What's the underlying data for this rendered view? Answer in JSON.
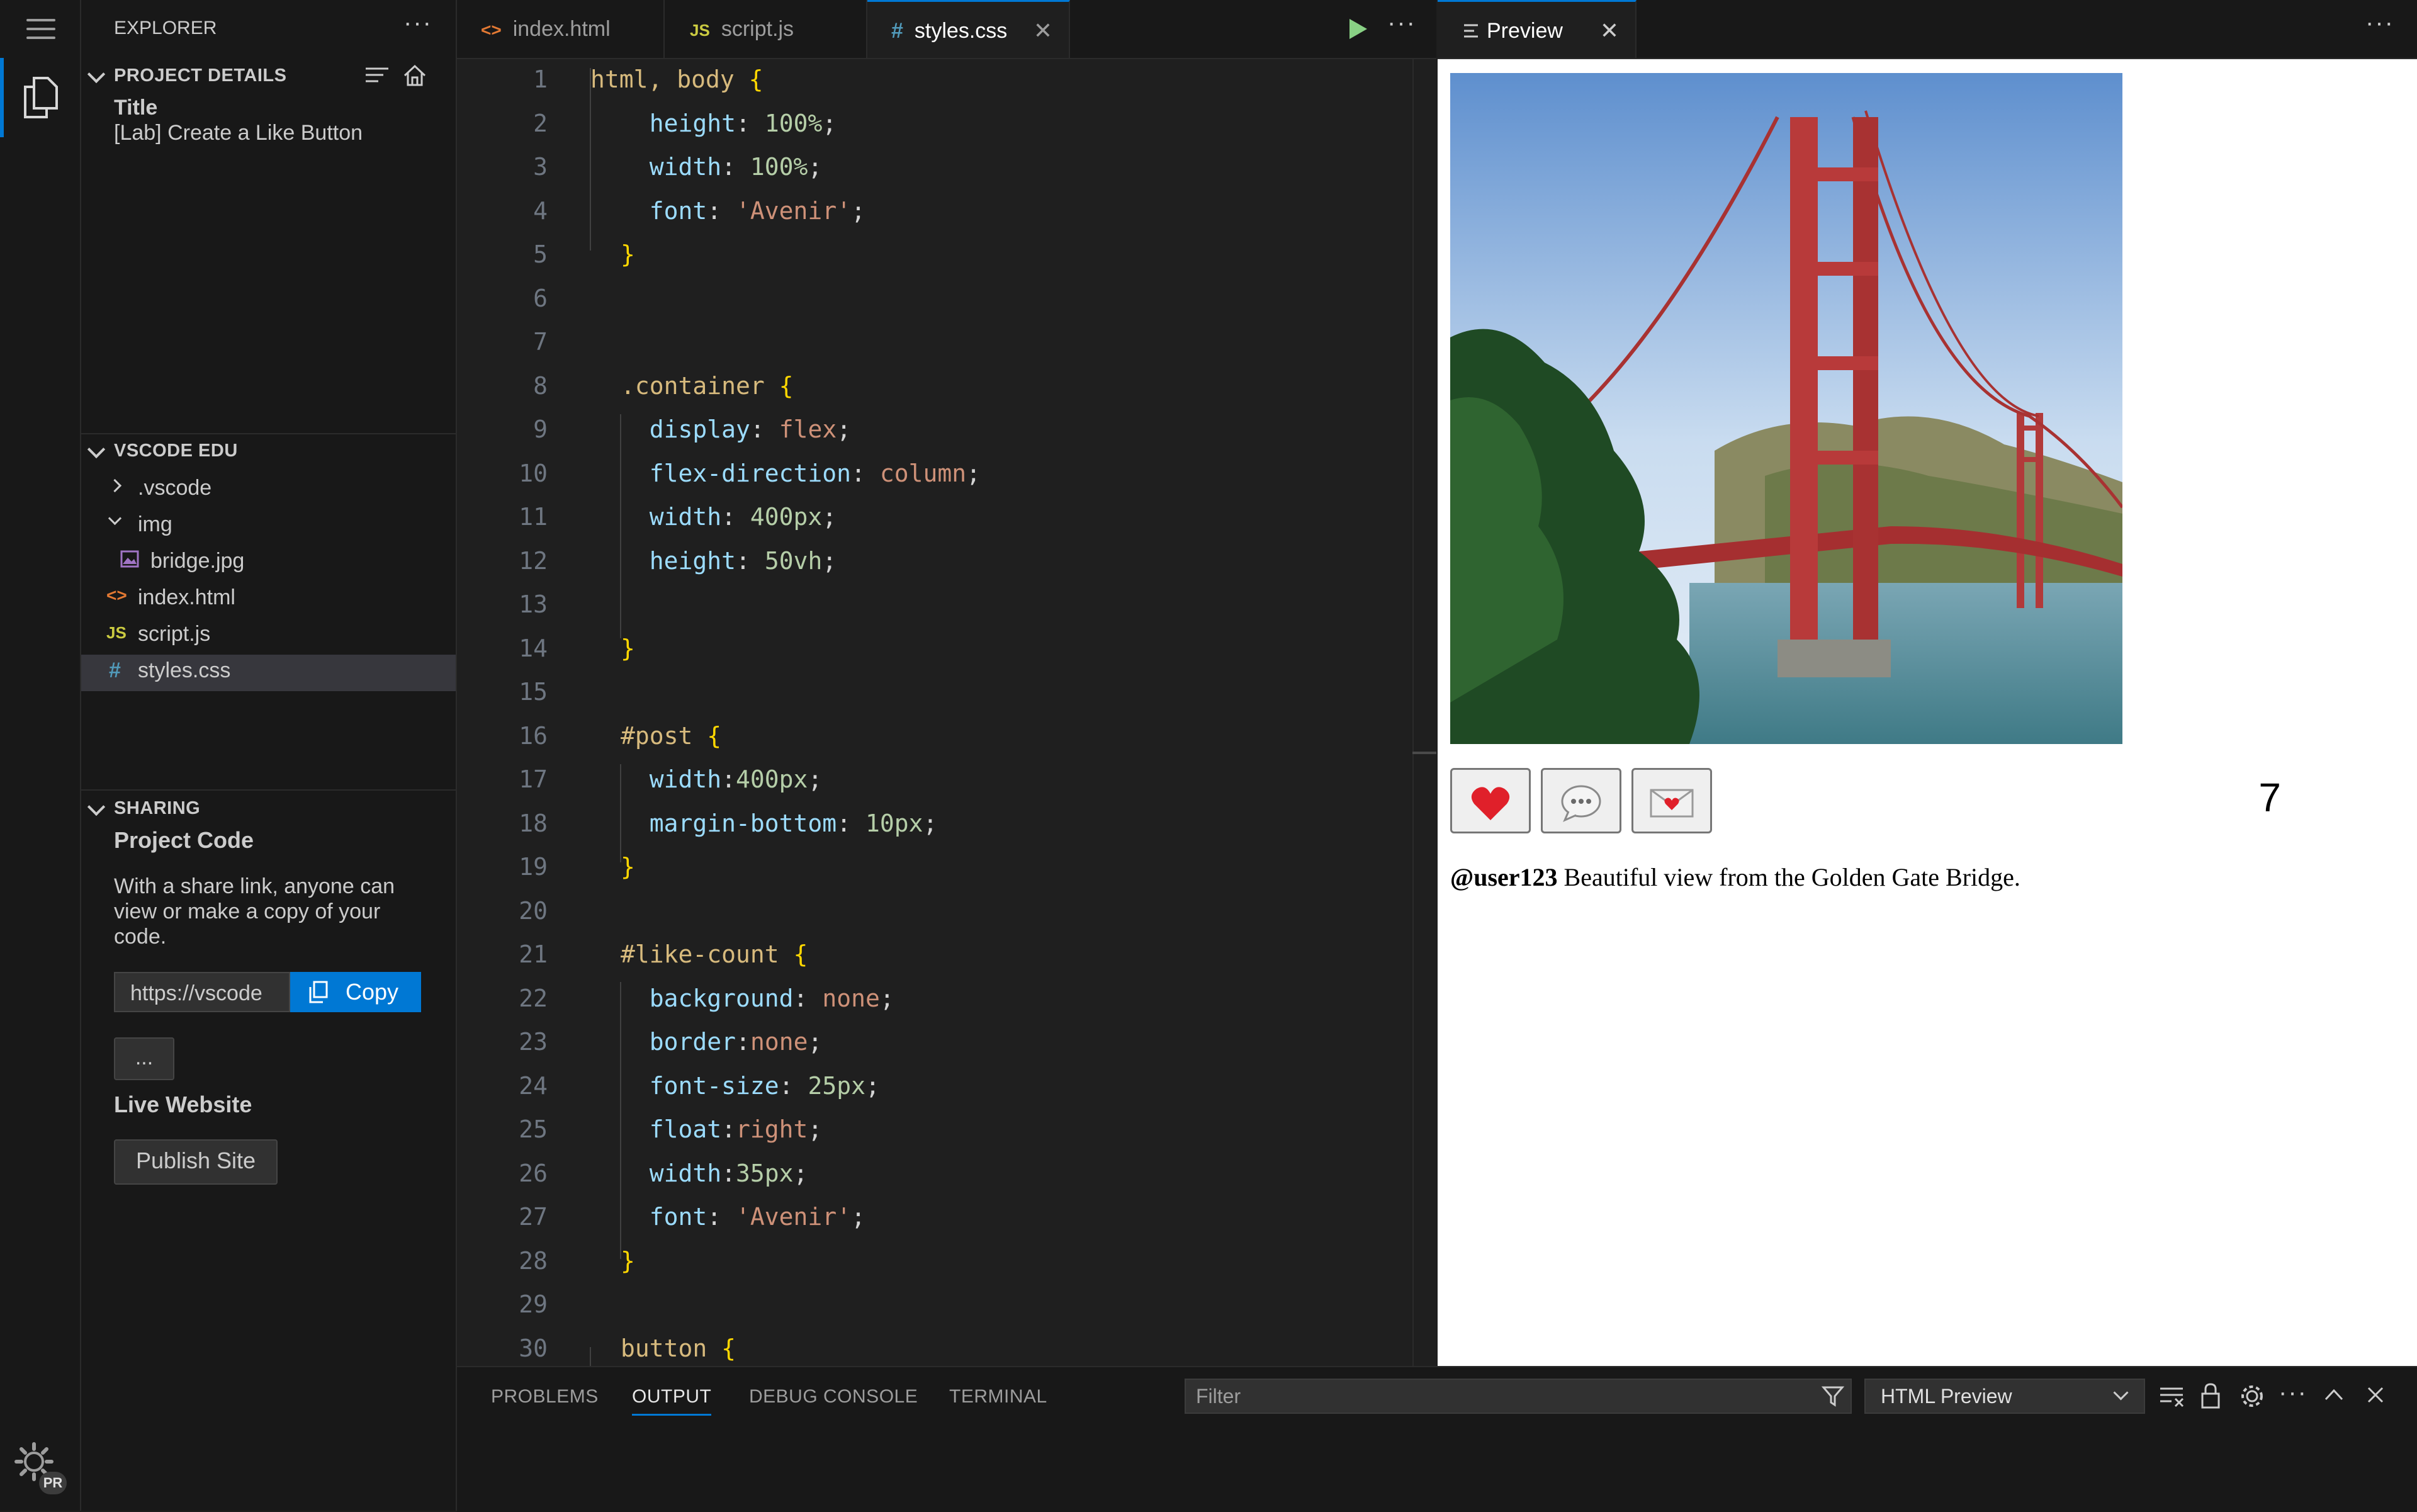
{
  "explorer": {
    "title": "EXPLORER",
    "more": "···",
    "project_details": {
      "heading": "PROJECT DETAILS",
      "title_label": "Title",
      "title_value": "[Lab] Create a Like Button"
    },
    "workspace": {
      "heading": "VSCODE EDU",
      "items": [
        {
          "label": ".vscode",
          "kind": "folder",
          "expanded": false
        },
        {
          "label": "img",
          "kind": "folder",
          "expanded": true
        },
        {
          "label": "bridge.jpg",
          "kind": "image"
        },
        {
          "label": "index.html",
          "kind": "html"
        },
        {
          "label": "script.js",
          "kind": "js"
        },
        {
          "label": "styles.css",
          "kind": "css",
          "selected": true
        }
      ]
    },
    "sharing": {
      "heading": "SHARING",
      "project_code_label": "Project Code",
      "description": "With a share link, anyone can view or make a copy of your code.",
      "link_value": "https://vscode",
      "copy_label": "Copy",
      "more_label": "...",
      "live_website_label": "Live Website",
      "publish_label": "Publish Site"
    }
  },
  "editor": {
    "tabs": [
      {
        "icon": "<>",
        "label": "index.html",
        "active": false
      },
      {
        "icon": "JS",
        "label": "script.js",
        "active": false
      },
      {
        "icon": "#",
        "label": "styles.css",
        "active": true
      }
    ],
    "more": "···",
    "line_numbers": [
      "1",
      "2",
      "3",
      "4",
      "5",
      "6",
      "7",
      "8",
      "9",
      "10",
      "11",
      "12",
      "13",
      "14",
      "15",
      "16",
      "17",
      "18",
      "19",
      "20",
      "21",
      "22",
      "23",
      "24",
      "25",
      "26",
      "27",
      "28",
      "29",
      "30"
    ],
    "lines": [
      [
        {
          "t": "html, body ",
          "c": "sel"
        },
        {
          "t": "{",
          "c": "brace"
        }
      ],
      [
        {
          "t": "  "
        },
        {
          "t": "height",
          "c": "prop"
        },
        {
          "t": ": "
        },
        {
          "t": "100%",
          "c": "num"
        },
        {
          "t": ";"
        }
      ],
      [
        {
          "t": "  "
        },
        {
          "t": "width",
          "c": "prop"
        },
        {
          "t": ": "
        },
        {
          "t": "100%",
          "c": "num"
        },
        {
          "t": ";"
        }
      ],
      [
        {
          "t": "  "
        },
        {
          "t": "font",
          "c": "prop"
        },
        {
          "t": ": "
        },
        {
          "t": "'Avenir'",
          "c": "str"
        },
        {
          "t": ";"
        }
      ],
      [
        {
          "t": "}",
          "c": "brace"
        }
      ],
      [],
      [],
      [
        {
          "t": ".container ",
          "c": "sel"
        },
        {
          "t": "{",
          "c": "brace"
        }
      ],
      [
        {
          "t": "  "
        },
        {
          "t": "display",
          "c": "prop"
        },
        {
          "t": ": "
        },
        {
          "t": "flex",
          "c": "str"
        },
        {
          "t": ";"
        }
      ],
      [
        {
          "t": "  "
        },
        {
          "t": "flex-direction",
          "c": "prop"
        },
        {
          "t": ": "
        },
        {
          "t": "column",
          "c": "str"
        },
        {
          "t": ";"
        }
      ],
      [
        {
          "t": "  "
        },
        {
          "t": "width",
          "c": "prop"
        },
        {
          "t": ": "
        },
        {
          "t": "400px",
          "c": "num"
        },
        {
          "t": ";"
        }
      ],
      [
        {
          "t": "  "
        },
        {
          "t": "height",
          "c": "prop"
        },
        {
          "t": ": "
        },
        {
          "t": "50vh",
          "c": "num"
        },
        {
          "t": ";"
        }
      ],
      [],
      [
        {
          "t": "}",
          "c": "brace"
        }
      ],
      [],
      [
        {
          "t": "#post ",
          "c": "sel"
        },
        {
          "t": "{",
          "c": "brace"
        }
      ],
      [
        {
          "t": "  "
        },
        {
          "t": "width",
          "c": "prop"
        },
        {
          "t": ":"
        },
        {
          "t": "400px",
          "c": "num"
        },
        {
          "t": ";"
        }
      ],
      [
        {
          "t": "  "
        },
        {
          "t": "margin-bottom",
          "c": "prop"
        },
        {
          "t": ": "
        },
        {
          "t": "10px",
          "c": "num"
        },
        {
          "t": ";"
        }
      ],
      [
        {
          "t": "}",
          "c": "brace"
        }
      ],
      [],
      [
        {
          "t": "#like-count ",
          "c": "sel"
        },
        {
          "t": "{",
          "c": "brace"
        }
      ],
      [
        {
          "t": "  "
        },
        {
          "t": "background",
          "c": "prop"
        },
        {
          "t": ": "
        },
        {
          "t": "none",
          "c": "str"
        },
        {
          "t": ";"
        }
      ],
      [
        {
          "t": "  "
        },
        {
          "t": "border",
          "c": "prop"
        },
        {
          "t": ":"
        },
        {
          "t": "none",
          "c": "str"
        },
        {
          "t": ";"
        }
      ],
      [
        {
          "t": "  "
        },
        {
          "t": "font-size",
          "c": "prop"
        },
        {
          "t": ": "
        },
        {
          "t": "25px",
          "c": "num"
        },
        {
          "t": ";"
        }
      ],
      [
        {
          "t": "  "
        },
        {
          "t": "float",
          "c": "prop"
        },
        {
          "t": ":"
        },
        {
          "t": "right",
          "c": "str"
        },
        {
          "t": ";"
        }
      ],
      [
        {
          "t": "  "
        },
        {
          "t": "width",
          "c": "prop"
        },
        {
          "t": ":"
        },
        {
          "t": "35px",
          "c": "num"
        },
        {
          "t": ";"
        }
      ],
      [
        {
          "t": "  "
        },
        {
          "t": "font",
          "c": "prop"
        },
        {
          "t": ": "
        },
        {
          "t": "'Avenir'",
          "c": "str"
        },
        {
          "t": ";"
        }
      ],
      [
        {
          "t": "}",
          "c": "brace"
        }
      ],
      [],
      [
        {
          "t": "button ",
          "c": "sel"
        },
        {
          "t": "{",
          "c": "brace"
        }
      ]
    ]
  },
  "preview": {
    "tab_label": "Preview",
    "more": "···",
    "like_count": "7",
    "caption_user": "@user123",
    "caption_text": " Beautiful view from the Golden Gate Bridge."
  },
  "panel": {
    "tabs": [
      {
        "label": "PROBLEMS",
        "active": false
      },
      {
        "label": "OUTPUT",
        "active": true
      },
      {
        "label": "DEBUG CONSOLE",
        "active": false
      },
      {
        "label": "TERMINAL",
        "active": false
      }
    ],
    "filter_placeholder": "Filter",
    "output_channel": "HTML Preview"
  },
  "activity": {
    "pr_badge": "PR"
  },
  "colors": {
    "accent": "#0078d4",
    "selector": "#d7ba7d",
    "property": "#9cdcfe",
    "number": "#b5cea8",
    "string": "#ce9178",
    "brace": "#ffd700"
  }
}
